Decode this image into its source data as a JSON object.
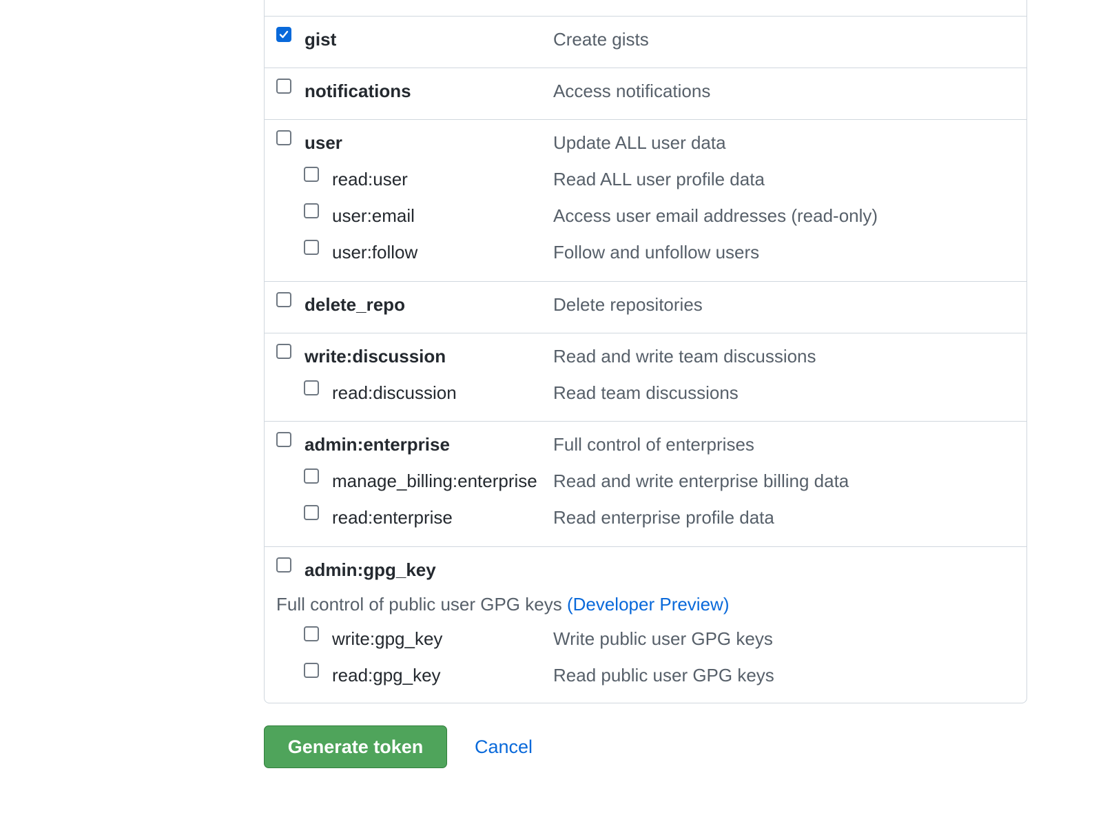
{
  "scopes": {
    "gist": {
      "name": "gist",
      "desc": "Create gists",
      "checked": true
    },
    "notifications": {
      "name": "notifications",
      "desc": "Access notifications",
      "checked": false
    },
    "user": {
      "name": "user",
      "desc": "Update ALL user data",
      "checked": false,
      "children": [
        {
          "name": "read:user",
          "desc": "Read ALL user profile data"
        },
        {
          "name": "user:email",
          "desc": "Access user email addresses (read-only)"
        },
        {
          "name": "user:follow",
          "desc": "Follow and unfollow users"
        }
      ]
    },
    "delete_repo": {
      "name": "delete_repo",
      "desc": "Delete repositories",
      "checked": false
    },
    "write_discussion": {
      "name": "write:discussion",
      "desc": "Read and write team discussions",
      "checked": false,
      "children": [
        {
          "name": "read:discussion",
          "desc": "Read team discussions"
        }
      ]
    },
    "admin_enterprise": {
      "name": "admin:enterprise",
      "desc": "Full control of enterprises",
      "checked": false,
      "children": [
        {
          "name": "manage_billing:enterprise",
          "desc": "Read and write enterprise billing data"
        },
        {
          "name": "read:enterprise",
          "desc": "Read enterprise profile data"
        }
      ]
    },
    "admin_gpg_key": {
      "name": "admin:gpg_key",
      "desc": "Full control of public user GPG keys",
      "preview_link": "(Developer Preview)",
      "checked": false,
      "children": [
        {
          "name": "write:gpg_key",
          "desc": "Write public user GPG keys"
        },
        {
          "name": "read:gpg_key",
          "desc": "Read public user GPG keys"
        }
      ]
    }
  },
  "actions": {
    "generate_label": "Generate token",
    "cancel_label": "Cancel"
  },
  "colors": {
    "accent": "#0969da",
    "primary_button": "#4fa45b",
    "border": "#d0d7de",
    "muted_text": "#57606a"
  }
}
